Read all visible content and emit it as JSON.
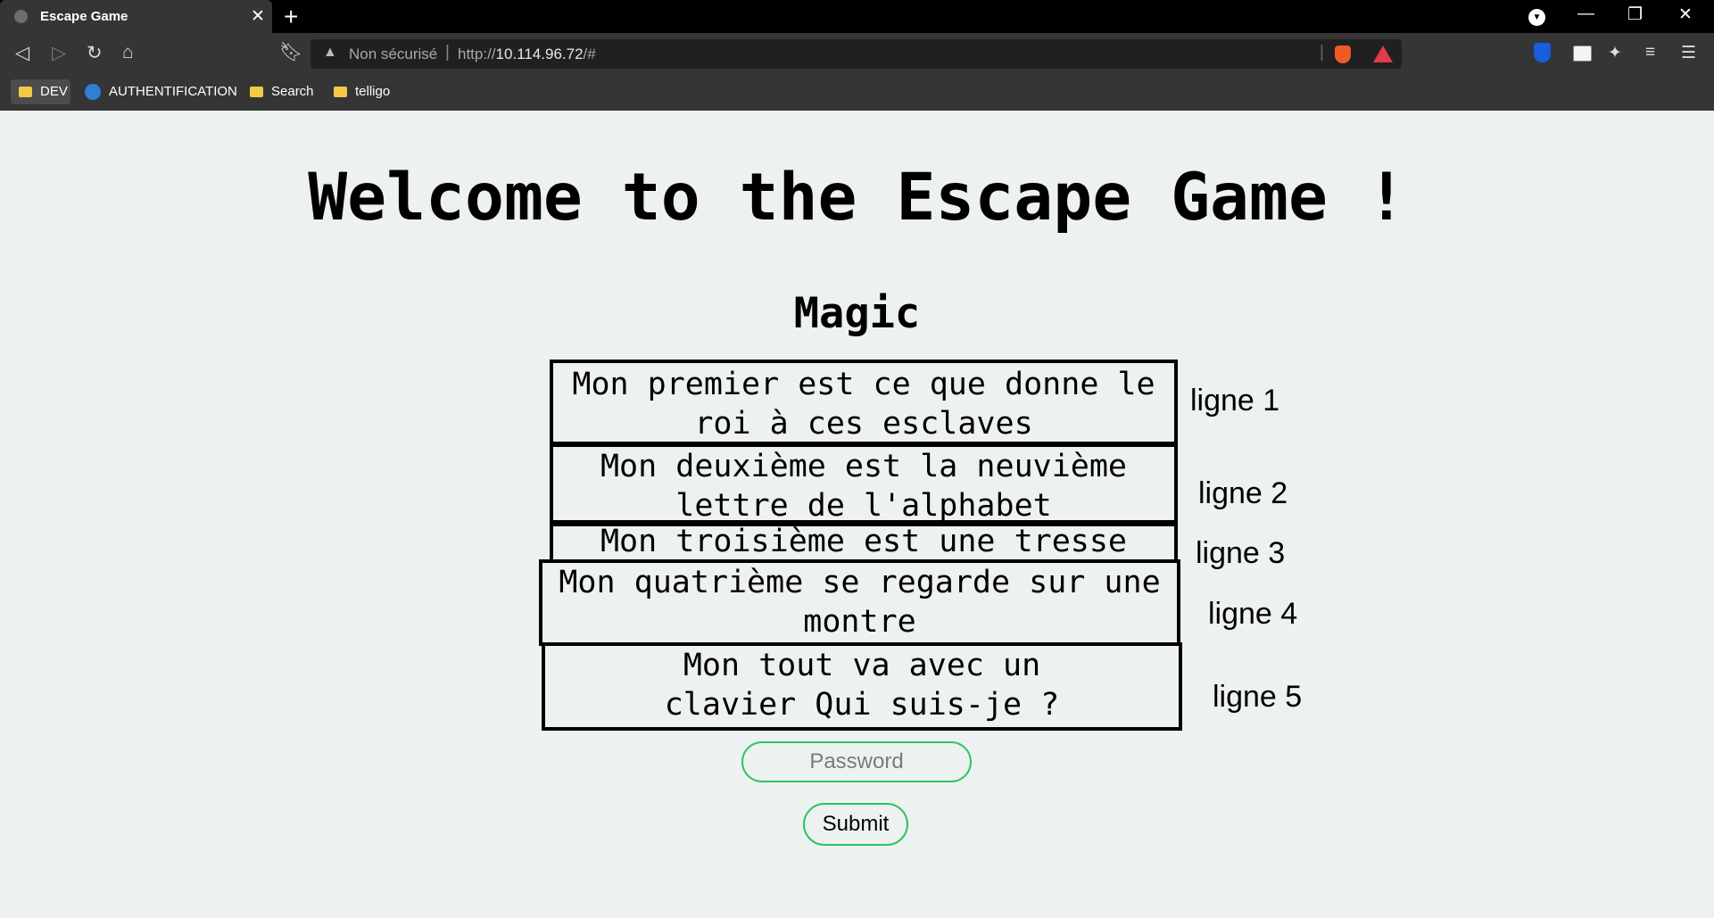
{
  "browser": {
    "tab_title": "Escape Game",
    "close_glyph": "✕",
    "new_tab_glyph": "+",
    "url_warning": "Non sécurisé",
    "url_scheme": "http://",
    "url_host": "10.114.96.72",
    "url_path": "/#",
    "bookmarks": [
      "DEV",
      "AUTHENTIFICATION",
      "Search",
      "telligo"
    ]
  },
  "page": {
    "title": "Welcome to the Escape Game !",
    "subtitle": "Magic",
    "riddles": [
      {
        "text": "Mon premier est ce que donne le roi à ces esclaves",
        "label": "ligne 1"
      },
      {
        "text": "Mon deuxième est la neuvième lettre de l'alphabet",
        "label": "ligne 2"
      },
      {
        "text": "Mon troisième est une tresse",
        "label": "ligne 3"
      },
      {
        "text": "Mon quatrième se regarde sur une montre",
        "label": "ligne 4"
      },
      {
        "text": "Mon tout va avec un clavier Qui suis-je ?",
        "label": "ligne 5"
      }
    ],
    "password_placeholder": "Password",
    "submit_label": "Submit"
  }
}
